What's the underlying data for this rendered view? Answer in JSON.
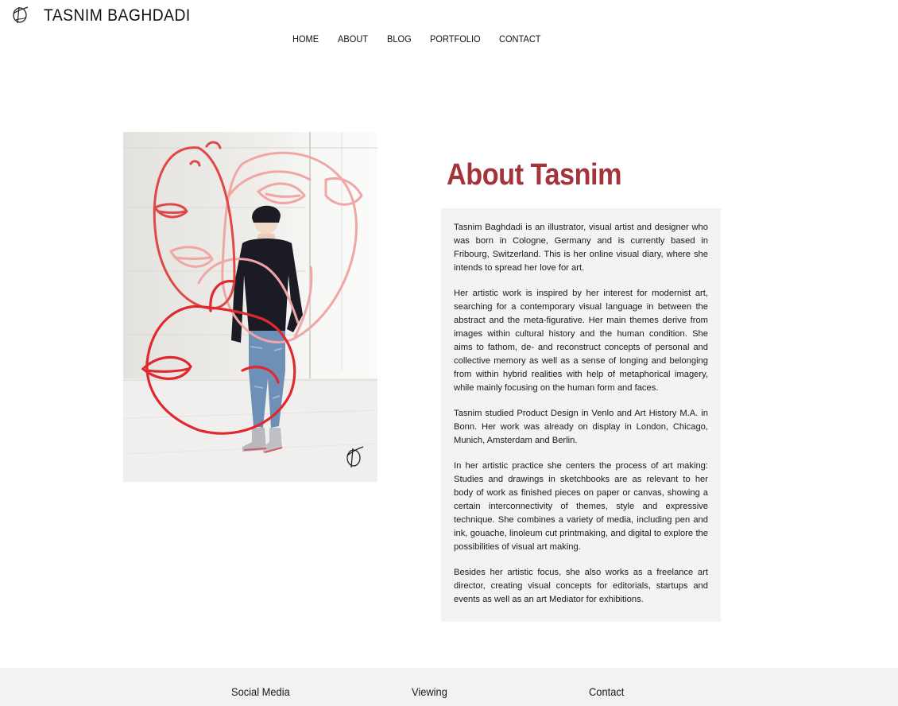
{
  "header": {
    "brand": "TASNIM BAGHDADI",
    "logo_icon": "signature-logo-icon"
  },
  "nav": {
    "items": [
      {
        "label": "HOME"
      },
      {
        "label": "ABOUT"
      },
      {
        "label": "BLOG"
      },
      {
        "label": "PORTFOLIO"
      },
      {
        "label": "CONTACT"
      }
    ]
  },
  "about": {
    "title": "About Tasnim",
    "title_color": "#a3343a",
    "paragraphs": [
      "Tasnim Baghdadi is an illustrator, visual artist and designer who was born in Cologne, Germany and is currently based in Fribourg, Switzerland. This is her online visual diary, where she intends to spread her love for art.",
      "Her artistic work is inspired by her interest for modernist art, searching for a contemporary visual language in between the abstract and the meta-figurative. Her main themes derive from images within cultural history and the human condition. She aims to fathom, de- and reconstruct concepts of personal and collective memory as well as a sense of longing and belonging from within hybrid realities with help of metaphorical imagery, while mainly focusing on the human form and faces.",
      "Tasnim studied Product Design in Venlo and Art History M.A. in Bonn. Her work was already on display in London, Chicago, Munich, Amsterdam and Berlin.",
      "In her artistic practice she centers the process of art making: Studies and drawings in sketchbooks are as relevant to her body of work as finished pieces on paper or canvas, showing a certain interconnectivity of themes, style and expressive technique. She combines a variety of media, including pen and ink, gouache, linoleum cut printmaking, and digital to explore the possibilities of visual art making.",
      "Besides her artistic focus, she also works as a freelance art director, creating visual concepts for editorials, startups and events as well as an art Mediator for exhibitions."
    ]
  },
  "footer": {
    "columns": [
      {
        "label": "Social Media"
      },
      {
        "label": "Viewing"
      },
      {
        "label": "Contact"
      }
    ]
  }
}
